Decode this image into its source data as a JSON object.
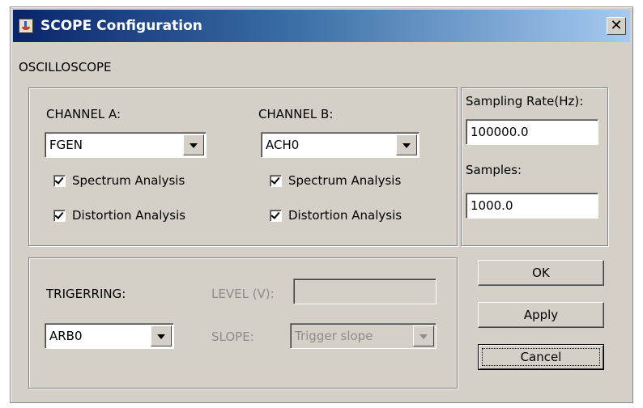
{
  "window": {
    "title": "SCOPE Configuration",
    "close_glyph": "✕"
  },
  "section_title": "OSCILLOSCOPE",
  "channel_a": {
    "label": "CHANNEL A:",
    "selected": "FGEN",
    "spectrum": "Spectrum Analysis",
    "distortion": "Distortion Analysis"
  },
  "channel_b": {
    "label": "CHANNEL B:",
    "selected": "ACH0",
    "spectrum": "Spectrum Analysis",
    "distortion": "Distortion Analysis"
  },
  "sampling": {
    "rate_label": "Sampling Rate(Hz):",
    "rate_value": "100000.0",
    "samples_label": "Samples:",
    "samples_value": "1000.0"
  },
  "trigger": {
    "label": "TRIGERRING:",
    "selected": "ARB0",
    "level_label": "LEVEL (V):",
    "level_value": "",
    "slope_label": "SLOPE:",
    "slope_placeholder": "Trigger slope"
  },
  "buttons": {
    "ok": "OK",
    "apply": "Apply",
    "cancel": "Cancel"
  },
  "icons": {
    "app": "java-cup-icon",
    "close": "close-icon",
    "dropdown": "chevron-down-icon",
    "check": "checkmark-icon"
  }
}
